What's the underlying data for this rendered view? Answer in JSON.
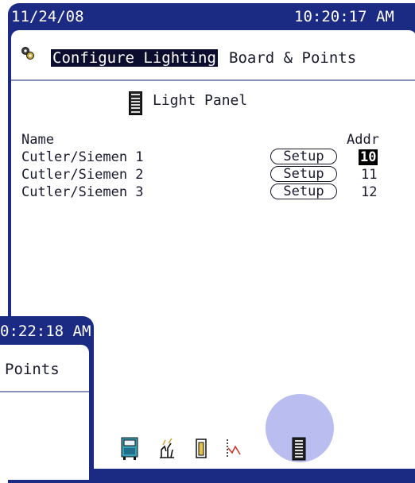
{
  "device": {
    "date": "11/24/08",
    "time": "10:20:17 AM",
    "title_highlight": "Configure Lighting",
    "title_rest": "Board & Points",
    "panel_label": "Light Panel",
    "columns": {
      "name": "Name",
      "addr": "Addr"
    },
    "rows": [
      {
        "name": "Cutler/Siemen 1",
        "button": "Setup",
        "addr": "10",
        "selected": true
      },
      {
        "name": "Cutler/Siemen 2",
        "button": "Setup",
        "addr": "11",
        "selected": false
      },
      {
        "name": "Cutler/Siemen 3",
        "button": "Setup",
        "addr": "12",
        "selected": false
      }
    ],
    "dock_icons": [
      "hvac-unit-icon",
      "lighting-hand-icon",
      "door-icon",
      "trend-chart-icon",
      "light-panel-icon"
    ],
    "active_dock_icon": "light-panel-icon"
  },
  "ghost_window": {
    "time": "0:22:18 AM",
    "title": "Points"
  },
  "colors": {
    "frame": "#1b2a82",
    "highlight": "#b9bdf0",
    "selection": "#000000"
  }
}
